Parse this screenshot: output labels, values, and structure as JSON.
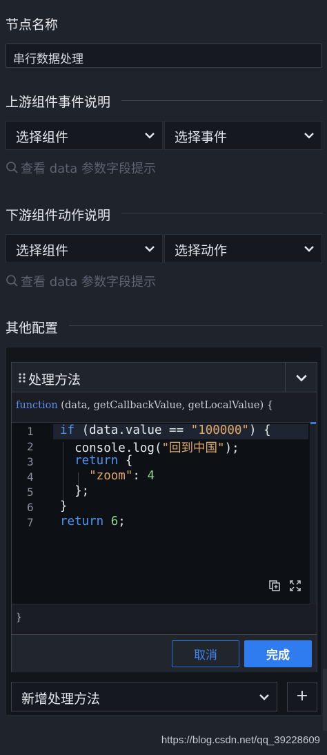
{
  "node_name": {
    "title": "节点名称",
    "value": "串行数据处理"
  },
  "upstream": {
    "title": "上游组件事件说明",
    "component_select": "选择组件",
    "event_select": "选择事件",
    "hint": "查看 data 参数字段提示"
  },
  "downstream": {
    "title": "下游组件动作说明",
    "component_select": "选择组件",
    "action_select": "选择动作",
    "hint": "查看 data 参数字段提示"
  },
  "other": {
    "title": "其他配置"
  },
  "method_card": {
    "title": "处理方法",
    "signature_kw": "function",
    "signature_rest": " (data, getCallbackValue, getLocalValue) {",
    "closing": "}",
    "cancel_label": "取消",
    "done_label": "完成"
  },
  "code": {
    "line_numbers": [
      "1",
      "2",
      "3",
      "4",
      "5",
      "6",
      "7"
    ],
    "l1_kw": "if",
    "l1_a": " (data.value == ",
    "l1_str": "\"100000\"",
    "l1_b": ") {",
    "l2_a": "  console.log(",
    "l2_str": "\"回到中国\"",
    "l2_b": ");",
    "l3_kw": "  return",
    "l3_b": " {",
    "l4_str": "    \"zoom\"",
    "l4_b": ": ",
    "l4_num": "4",
    "l5": "  };",
    "l6": "}",
    "l7_kw": "return",
    "l7_num": " 6",
    "l7_b": ";"
  },
  "add_method": {
    "label": "新增处理方法",
    "plus": "+"
  },
  "watermark": "https://blog.csdn.net/qq_39228609",
  "colors": {
    "accent": "#2f7bf0",
    "keyword": "#4e94f2",
    "string": "#e0a86a",
    "number": "#8ed38e",
    "background": "#1f232b"
  }
}
